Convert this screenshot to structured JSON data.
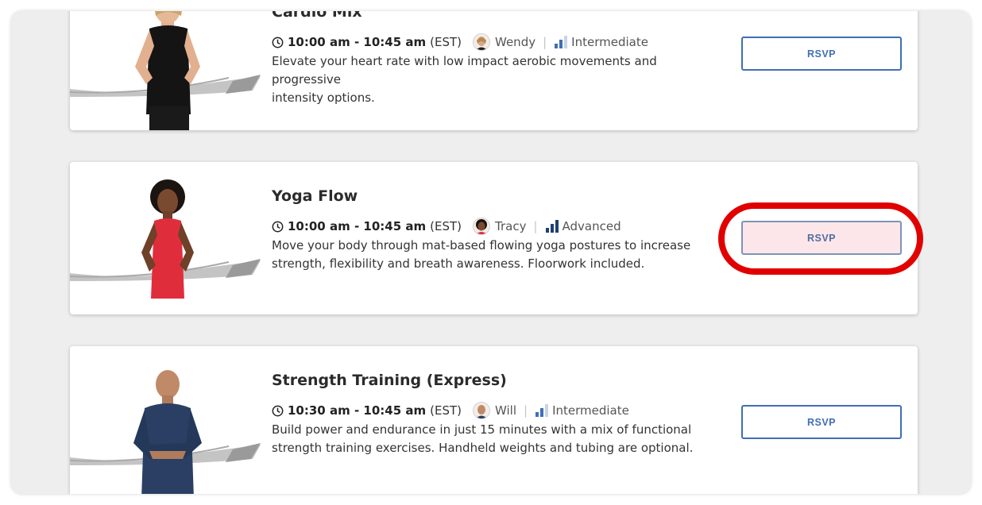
{
  "classes": [
    {
      "title": "Cardio Mix",
      "time": "10:00 am - 10:45 am",
      "timezone": "(EST)",
      "instructor": "Wendy",
      "level": "Intermediate",
      "level_bars": 2,
      "description_line1": "Elevate your heart rate with low impact aerobic movements and progressive",
      "description_line2": "intensity options.",
      "rsvp_label": "RSVP"
    },
    {
      "title": "Yoga Flow",
      "time": "10:00 am - 10:45 am",
      "timezone": "(EST)",
      "instructor": "Tracy",
      "level": "Advanced",
      "level_bars": 3,
      "description_line1": "Move your body through mat-based flowing yoga postures to increase",
      "description_line2": "strength, flexibility and breath awareness. Floorwork included.",
      "rsvp_label": "RSVP"
    },
    {
      "title": "Strength Training (Express)",
      "time": "10:30 am - 10:45 am",
      "timezone": "(EST)",
      "instructor": "Will",
      "level": "Intermediate",
      "level_bars": 2,
      "description_line1": "Build power and endurance in just 15 minutes with a mix of functional",
      "description_line2": "strength training exercises. Handheld weights and tubing are optional.",
      "rsvp_label": "RSVP"
    }
  ],
  "colors": {
    "accent": "#3f6fb4",
    "highlight": "#e00000",
    "pressed_bg": "#fde6ea",
    "page_bg": "#eeeeee"
  },
  "icons": {
    "clock": "clock-icon",
    "level": "signal-bars-icon"
  }
}
